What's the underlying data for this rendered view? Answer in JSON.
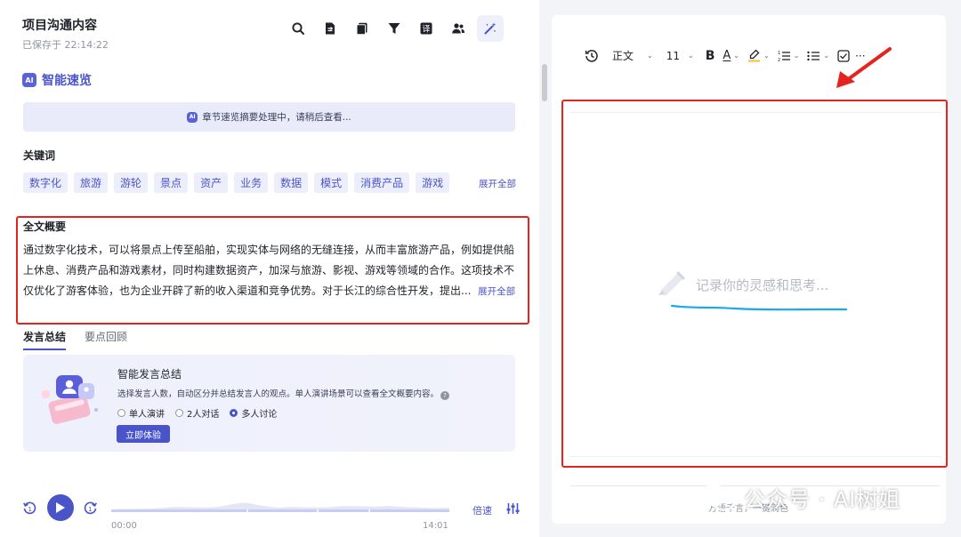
{
  "header": {
    "title": "项目沟通内容",
    "saved": "已保存于 22:14:22",
    "toolbar_icons": [
      "search-icon",
      "document-icon",
      "copy-icon",
      "filter-icon",
      "translate-icon",
      "users-icon",
      "ai-wand-icon"
    ],
    "translate_glyph": "译"
  },
  "ai_overview": {
    "badge": "AI",
    "title": "智能速览",
    "processing_text": "章节速览摘要处理中，请稍后查看..."
  },
  "keywords": {
    "title": "关键词",
    "items": [
      "数字化",
      "旅游",
      "游轮",
      "景点",
      "资产",
      "业务",
      "数据",
      "模式",
      "消费产品",
      "游戏"
    ],
    "expand_label": "展开全部"
  },
  "summary": {
    "title": "全文概要",
    "lines": [
      "通过数字化技术，可以将景点上传至船舶，实现实体与网络的无缝连接，从而丰富旅游产品，例如提供船",
      "上休息、消费产品和游戏素材，同时构建数据资产，加深与旅游、影视、游戏等领域的合作。这项技术不",
      "仅优化了游客体验，也为企业开辟了新的收入渠道和竞争优势。对于长江的综合性开发，提出..."
    ],
    "expand_label": "展开全部"
  },
  "tabs": [
    {
      "label": "发言总结",
      "active": true
    },
    {
      "label": "要点回顾",
      "active": false
    }
  ],
  "speech_card": {
    "title": "智能发言总结",
    "description": "选择发言人数，自动区分并总结发言人的观点。单人演讲场景可以查看全文概要内容。",
    "help_glyph": "?",
    "options": [
      {
        "label": "单人演讲",
        "selected": false
      },
      {
        "label": "2人对话",
        "selected": false
      },
      {
        "label": "多人讨论",
        "selected": true
      }
    ],
    "button_label": "立即体验"
  },
  "player": {
    "current_time": "00:00",
    "total_time": "14:01",
    "speed_label": "倍速"
  },
  "editor": {
    "format_style": "正文",
    "font_size": "11",
    "bold_label": "B",
    "font_color_label": "A",
    "more_label": "···",
    "placeholder": "记录你的灵感和思考...",
    "footer_text": "万语千言，一键润色"
  },
  "watermark": {
    "text": "公众号 · AI树姐"
  },
  "colors": {
    "accent": "#4a54c9",
    "annotation_red": "#e6231e",
    "annotation_blue": "#1aa7ec"
  }
}
